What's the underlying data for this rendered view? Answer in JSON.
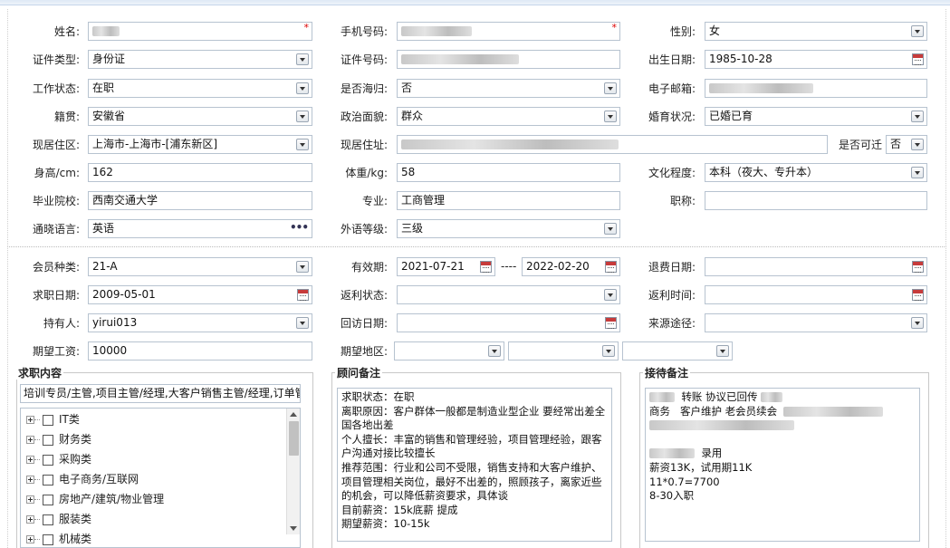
{
  "row1": {
    "name_label": "姓名:",
    "mobile_label": "手机号码:",
    "gender_label": "性别:",
    "gender_value": "女",
    "required_mark": "*"
  },
  "row2": {
    "idtype_label": "证件类型:",
    "idtype_value": "身份证",
    "idno_label": "证件号码:",
    "birth_label": "出生日期:",
    "birth_value": "1985-10-28"
  },
  "row3": {
    "workstatus_label": "工作状态:",
    "workstatus_value": "在职",
    "overseas_label": "是否海归:",
    "overseas_value": "否",
    "email_label": "电子邮箱:"
  },
  "row4": {
    "native_label": "籍贯:",
    "native_value": "安徽省",
    "political_label": "政治面貌:",
    "political_value": "群众",
    "marital_label": "婚育状况:",
    "marital_value": "已婚已育"
  },
  "row5": {
    "district_label": "现居住区:",
    "district_value": "上海市-上海市-[浦东新区]",
    "address_label": "现居住址:",
    "relocate_label": "是否可迁",
    "relocate_value": "否"
  },
  "row6": {
    "height_label": "身高/cm:",
    "height_value": "162",
    "weight_label": "体重/kg:",
    "weight_value": "58",
    "education_label": "文化程度:",
    "education_value": "本科（夜大、专升本）"
  },
  "row7": {
    "school_label": "毕业院校:",
    "school_value": "西南交通大学",
    "major_label": "专业:",
    "major_value": "工商管理",
    "title_label": "职称:"
  },
  "row8": {
    "language_label": "通晓语言:",
    "language_value": "英语",
    "language_more": "•••",
    "langlevel_label": "外语等级:",
    "langlevel_value": "三级"
  },
  "row9": {
    "member_label": "会员种类:",
    "member_value": "21-A",
    "valid_label": "有效期:",
    "valid_from": "2021-07-21",
    "valid_sep": "----",
    "valid_to": "2022-02-20",
    "refund_label": "退费日期:"
  },
  "row10": {
    "jobdate_label": "求职日期:",
    "jobdate_value": "2009-05-01",
    "rebate_status_label": "返利状态:",
    "rebate_time_label": "返利时间:"
  },
  "row11": {
    "holder_label": "持有人:",
    "holder_value": "yirui013",
    "visit_label": "回访日期:",
    "source_label": "来源途径:"
  },
  "row12": {
    "salary_label": "期望工资:",
    "salary_value": "10000",
    "region_label": "期望地区:"
  },
  "job_content": {
    "title": "求职内容",
    "summary": "培训专员/主管,项目主管/经理,大客户销售主管/经理,订单管",
    "items": [
      "IT类",
      "财务类",
      "采购类",
      "电子商务/互联网",
      "房地产/建筑/物业管理",
      "服装类",
      "机械类"
    ]
  },
  "consultant_notes": {
    "title": "顾问备注",
    "lines": [
      "求职状态：在职",
      "离职原因：客户群体一般都是制造业型企业 要经常出差全国各地出差",
      "个人擅长：丰富的销售和管理经验，项目管理经验，跟客户沟通对接比较擅长",
      "推荐范围：行业和公司不受限，销售支持和大客户维护、项目管理相关岗位，最好不出差的，照顾孩子，离家近些的机会，可以降低薪资要求，具体谈",
      "目前薪资：15k底薪 提成",
      "期望薪资：10-15k"
    ]
  },
  "reception_notes": {
    "title": "接待备注",
    "l1": "转账 协议已回传",
    "l2a": "商务",
    "l2b": "客户维护 老会员续会",
    "l3": "录用",
    "l4": "薪资13K，试用期11K",
    "l5": "11*0.7=7700",
    "l6": "8-30入职"
  },
  "icons": {
    "dropdown": "chevron-down-icon",
    "calendar": "calendar-icon",
    "more": "ellipsis-icon",
    "expand": "plus-square-icon"
  },
  "colors": {
    "required": "#dd0000",
    "border": "#b7c3d0"
  }
}
